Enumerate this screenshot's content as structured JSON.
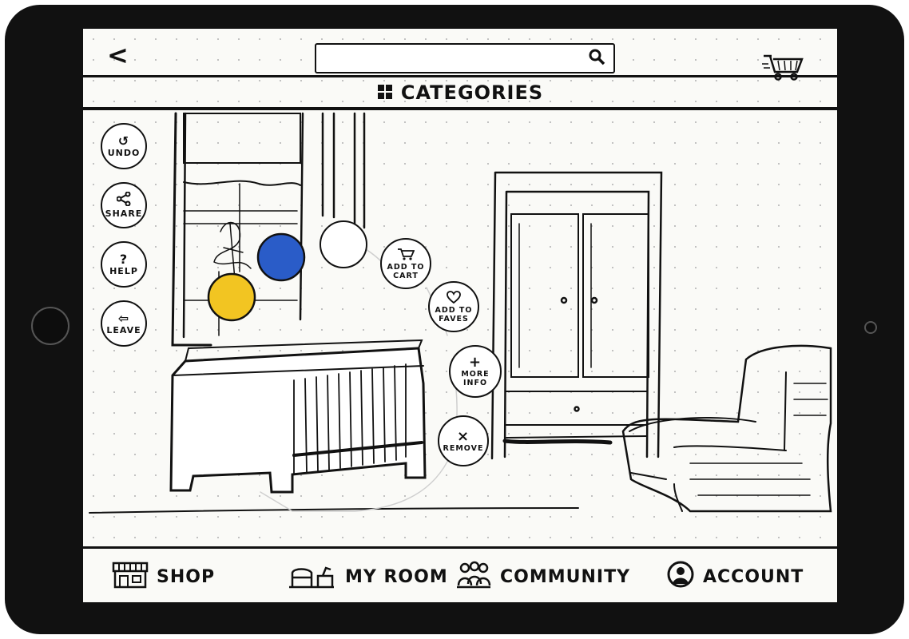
{
  "header": {
    "back_glyph": "<",
    "search": {
      "value": "",
      "placeholder": ""
    },
    "categories_label": "CATEGORIES"
  },
  "toolbar": [
    {
      "id": "undo",
      "label": "UNDO",
      "glyph": "↺"
    },
    {
      "id": "share",
      "label": "SHARE",
      "glyph": "⋖"
    },
    {
      "id": "help",
      "label": "HELP",
      "glyph": "?"
    },
    {
      "id": "leave",
      "label": "LEAVE",
      "glyph": "⇦"
    }
  ],
  "actions": {
    "add_to_cart": {
      "line1": "ADD TO",
      "line2": "CART"
    },
    "add_to_faves": {
      "line1": "ADD TO",
      "line2": "FAVES"
    },
    "more_info": {
      "glyph": "+",
      "line1": "MORE",
      "line2": "INFO"
    },
    "remove": {
      "glyph": "×",
      "label": "REMOVE"
    }
  },
  "colors": {
    "blue": "#2a5cc8",
    "yellow": "#f2c522",
    "ink": "#111111",
    "paper": "#fafaf7"
  },
  "nav": {
    "shop": "SHOP",
    "my_room": "MY ROOM",
    "community": "COMMUNITY",
    "account": "ACCOUNT"
  },
  "icons": [
    "back-icon",
    "search-icon",
    "cart-icon",
    "categories-grid-icon",
    "undo-icon",
    "share-icon",
    "help-icon",
    "leave-icon",
    "heart-icon",
    "plus-icon",
    "close-icon",
    "shop-icon",
    "room-icon",
    "community-icon",
    "account-icon"
  ]
}
